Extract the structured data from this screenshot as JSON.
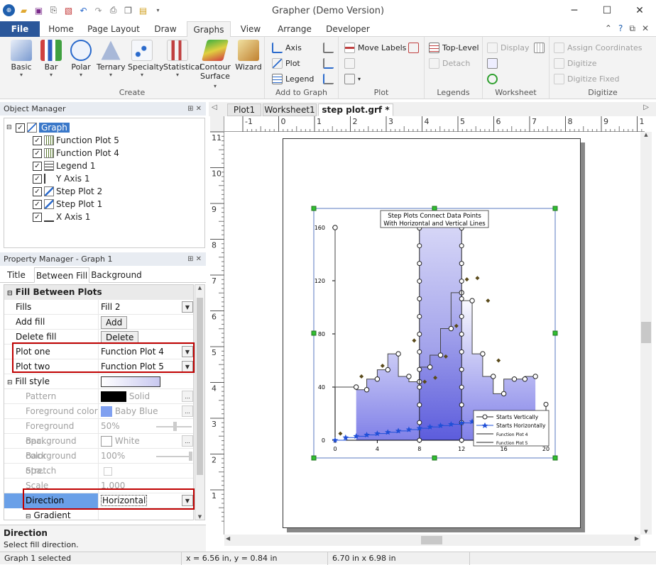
{
  "window": {
    "title": "Grapher (Demo Version)",
    "minimize": "─",
    "maximize": "☐",
    "close": "✕"
  },
  "menu_tabs": [
    "File",
    "Home",
    "Page Layout",
    "Draw",
    "Graphs",
    "View",
    "Arrange",
    "Developer"
  ],
  "active_tab": "Graphs",
  "ribbon": {
    "create": {
      "label": "Create",
      "buttons": [
        "Basic",
        "Bar",
        "Polar",
        "Ternary",
        "Specialty",
        "Statistical",
        "Contour",
        "Surface",
        "Wizard"
      ]
    },
    "add_to_graph": {
      "label": "Add to Graph",
      "buttons": [
        "Axis",
        "Plot",
        "Legend"
      ]
    },
    "plot": {
      "label": "Plot",
      "buttons": [
        "Move Labels"
      ]
    },
    "legends": {
      "label": "Legends",
      "buttons": [
        "Top-Level",
        "Detach"
      ]
    },
    "worksheet": {
      "label": "Worksheet",
      "buttons": [
        "Display"
      ]
    },
    "digitize": {
      "label": "Digitize",
      "buttons": [
        "Assign Coordinates",
        "Digitize",
        "Digitize Fixed"
      ]
    }
  },
  "object_manager": {
    "title": "Object Manager",
    "pin": "⊞ ✕",
    "items": [
      {
        "label": "Graph",
        "level": 0,
        "selected": true
      },
      {
        "label": "Function Plot 5",
        "level": 1
      },
      {
        "label": "Function Plot 4",
        "level": 1
      },
      {
        "label": "Legend 1",
        "level": 1
      },
      {
        "label": "Y Axis 1",
        "level": 1
      },
      {
        "label": "Step Plot 2",
        "level": 1
      },
      {
        "label": "Step Plot 1",
        "level": 1
      },
      {
        "label": "X Axis 1",
        "level": 1
      }
    ]
  },
  "property_manager": {
    "title": "Property Manager - Graph 1",
    "pin": "⊞ ✕",
    "tabs": [
      "Title",
      "Between Fill",
      "Background"
    ],
    "active_tab": "Between Fill",
    "section": "Fill Between Plots",
    "rows": [
      {
        "name": "Fills",
        "value": "Fill 2",
        "control": "dropdown"
      },
      {
        "name": "Add fill",
        "value": "Add",
        "control": "button"
      },
      {
        "name": "Delete fill",
        "value": "Delete",
        "control": "button"
      },
      {
        "name": "Plot one",
        "value": "Function Plot 4",
        "control": "dropdown"
      },
      {
        "name": "Plot two",
        "value": "Function Plot 5",
        "control": "dropdown"
      },
      {
        "name": "Fill style",
        "value": "",
        "control": "swatch"
      },
      {
        "name": "Pattern",
        "value": "Solid",
        "control": "swatch-dim"
      },
      {
        "name": "Foreground color",
        "value": "Baby Blue",
        "control": "color-dim"
      },
      {
        "name": "Foreground opa...",
        "value": "50%",
        "control": "slider-dim"
      },
      {
        "name": "Background color",
        "value": "White",
        "control": "color-dim"
      },
      {
        "name": "Background opa...",
        "value": "100%",
        "control": "slider-dim"
      },
      {
        "name": "Stretch",
        "value": "",
        "control": "check-dim"
      },
      {
        "name": "Scale",
        "value": "1.000",
        "control": "text-dim"
      },
      {
        "name": "Direction",
        "value": "Horizontal",
        "control": "dropdown-selected"
      },
      {
        "name": "Gradient",
        "value": "",
        "control": "subsection"
      }
    ],
    "description": {
      "heading": "Direction",
      "text": "Select fill direction."
    }
  },
  "doc_tabs": [
    "Plot1",
    "Worksheet1",
    "step plot.grf *"
  ],
  "active_doc_tab": "step plot.grf *",
  "rulers": {
    "h_labels": [
      "-1",
      "0",
      "1",
      "2",
      "3",
      "4",
      "5",
      "6",
      "7",
      "8",
      "9",
      "10"
    ],
    "v_labels": [
      "11",
      "10",
      "9",
      "8",
      "7",
      "6",
      "5",
      "4",
      "3",
      "2",
      "1"
    ]
  },
  "status": {
    "selection": "Graph 1 selected",
    "coords": "x = 6.56 in, y = 0.84 in",
    "size": "6.70 in x 6.98 in"
  },
  "chart_data": {
    "type": "line",
    "title": "Step Plots Connect Data Points\nWith Horizontal and Vertical Lines",
    "title_lines": [
      "Step Plots Connect Data Points",
      "With Horizontal and Vertical Lines"
    ],
    "xlim": [
      0,
      20
    ],
    "ylim": [
      0,
      160
    ],
    "x_ticks": [
      "0",
      "4",
      "8",
      "12",
      "16",
      "20"
    ],
    "y_ticks": [
      "0",
      "40",
      "80",
      "120",
      "160"
    ],
    "colors": {
      "fill_light": "#ffffff",
      "fill_dark": "#8080e8",
      "series1": "#444444",
      "series2": "#1f4fd8",
      "diamond": "#5a4a1a"
    },
    "series": [
      {
        "name": "Starts Vertically",
        "style": "step-vertical",
        "x": [
          0,
          2,
          3,
          4,
          5,
          6,
          7,
          8,
          9,
          10,
          11,
          12,
          13,
          14,
          15,
          16,
          17,
          18,
          19
        ],
        "y": [
          160,
          40,
          38,
          46,
          53,
          65,
          48,
          44,
          55,
          64,
          84,
          111,
          105,
          65,
          48,
          35,
          46,
          46,
          48
        ]
      },
      {
        "name": "Starts Horizontally",
        "style": "step-horizontal",
        "x": [
          0,
          1,
          2,
          3,
          4,
          5,
          6,
          7,
          8,
          9,
          10,
          11,
          12,
          13,
          14,
          15
        ],
        "y": [
          0,
          2,
          3,
          4,
          5,
          6,
          7,
          8,
          9,
          10,
          11,
          12,
          13,
          14,
          15,
          16
        ]
      },
      {
        "name": "Function Plot 4",
        "style": "line",
        "x": [],
        "y": []
      },
      {
        "name": "Function Plot 5",
        "style": "line",
        "x": [],
        "y": []
      }
    ],
    "diamonds": {
      "x": [
        0.5,
        2.5,
        4.5,
        7.5,
        8.5,
        9.5,
        10.5,
        11.5,
        12.5,
        13.5,
        14.5,
        15.5
      ],
      "y": [
        5,
        48,
        56,
        75,
        44,
        47,
        63,
        86,
        121,
        122,
        105,
        60
      ]
    },
    "legend": {
      "placement": "bottom-right",
      "entries": [
        "Starts Vertically",
        "Starts Horizontally",
        "Function Plot 4",
        "Function Plot 5"
      ]
    }
  }
}
